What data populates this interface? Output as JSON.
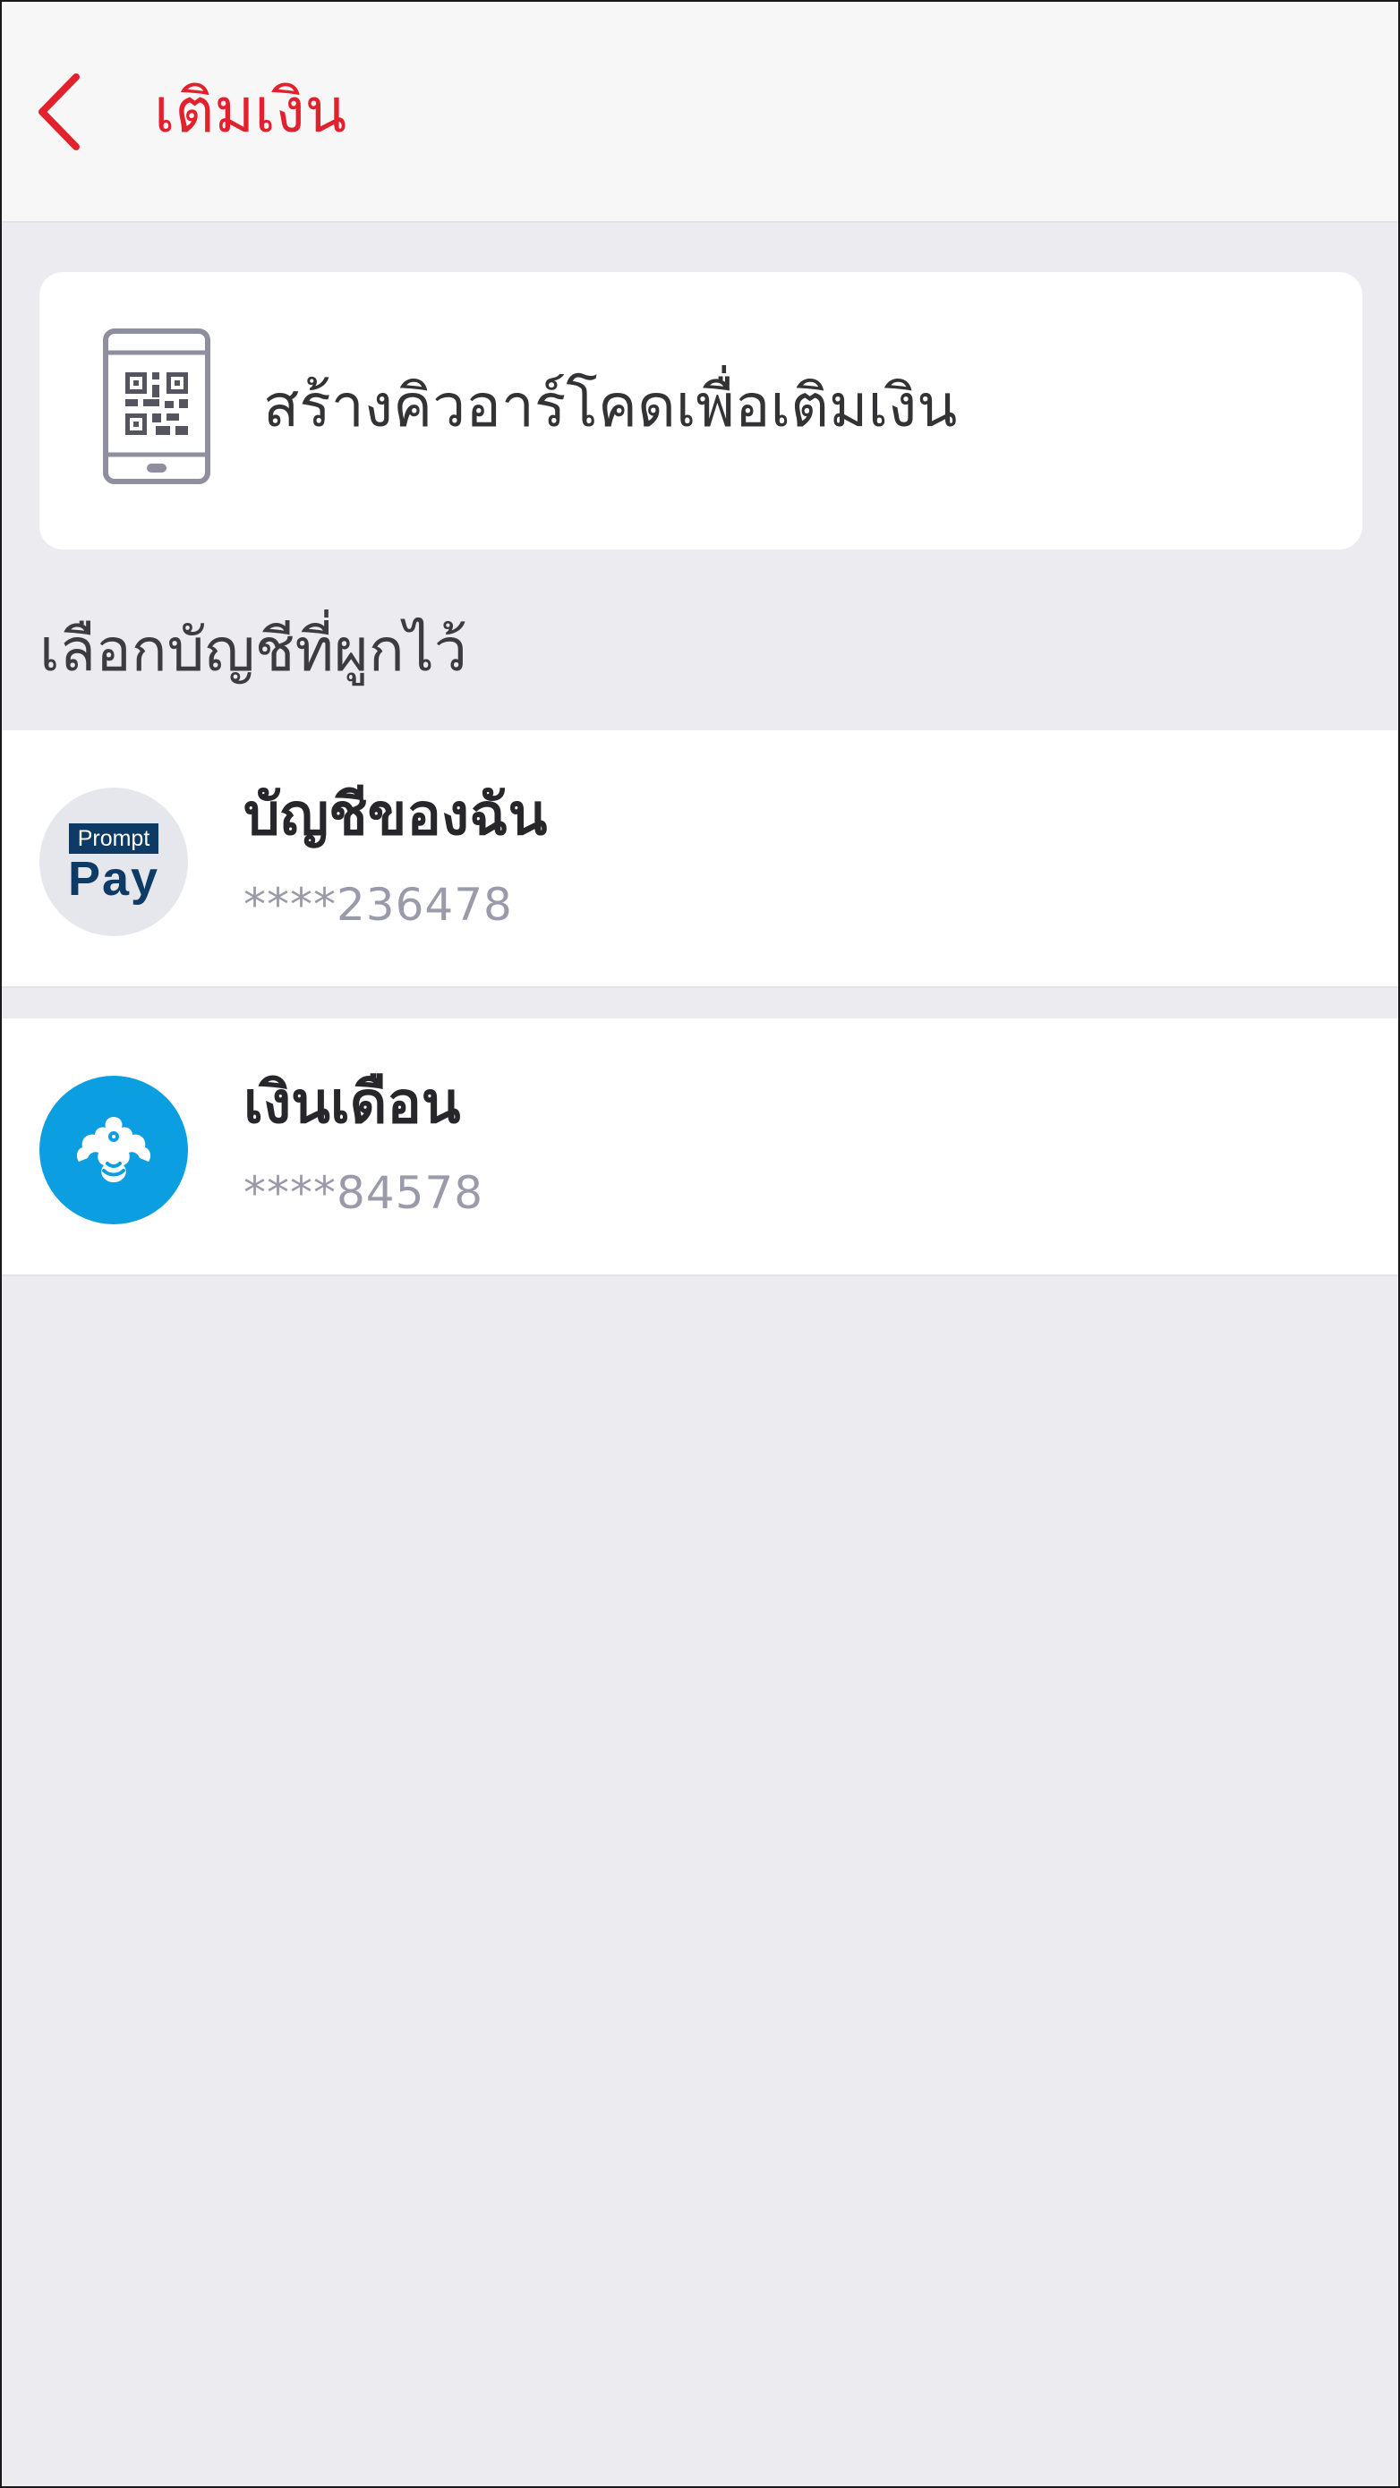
{
  "header": {
    "back_icon": "chevron-left-icon",
    "title": "เติมเงิน"
  },
  "qr_card": {
    "icon": "qr-phone-icon",
    "label": "สร้างคิวอาร์โคดเพื่อเติมเงิน"
  },
  "section": {
    "title": "เลือกบัญชีที่ผูกไว้"
  },
  "accounts": [
    {
      "name": "บัญชีของฉัน",
      "number": "****236478",
      "logo": "promptpay-logo",
      "logo_text_top": "Prompt",
      "logo_text_bottom": "Pay"
    },
    {
      "name": "เงินเดือน",
      "number": "****84578",
      "logo": "kbank-logo"
    }
  ],
  "colors": {
    "accent": "#e3212c",
    "background": "#ebebf0",
    "kbank_blue": "#0b9ee0",
    "promptpay_navy": "#0e3a66"
  }
}
